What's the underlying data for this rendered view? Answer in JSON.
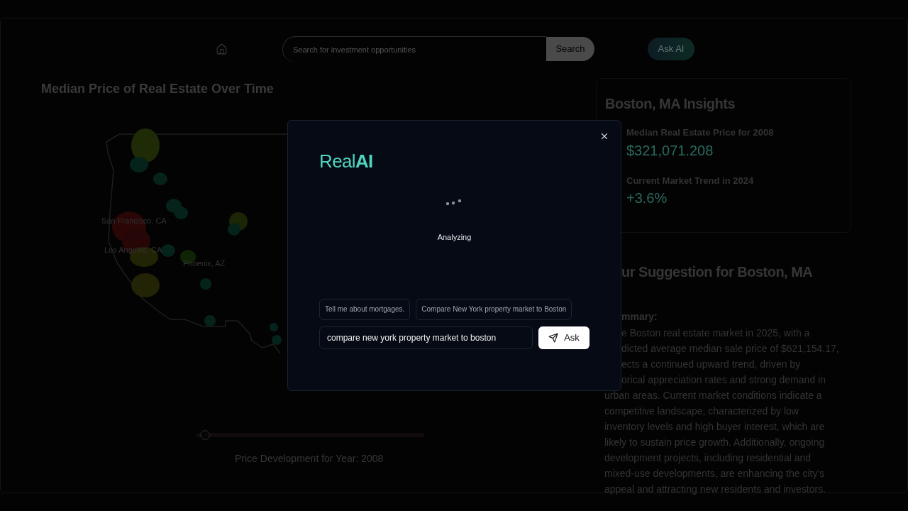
{
  "header": {
    "search": {
      "placeholder": "Search for investment opportunities"
    },
    "search_button": "Search",
    "ask_ai_button": "Ask AI"
  },
  "map_panel": {
    "title": "Median Price of Real Estate Over Time",
    "city_labels": [
      "San Francisco, CA",
      "Los Angeles, CA",
      "Phoenix, AZ"
    ],
    "year_slider": {
      "level": 0.02
    },
    "slider_caption": "Price Development for Year: 2008"
  },
  "insights": {
    "title": "Boston, MA Insights",
    "metrics": [
      {
        "label": "Median Real Estate Price for 2008",
        "value": "$321,071.208"
      },
      {
        "label": "Current Market Trend in 2024",
        "value": "+3.6%"
      }
    ]
  },
  "suggestion": {
    "title": "ur Suggestion for Boston, MA",
    "summary_heading": "mmary:",
    "summary_lines": [
      {
        "kind": "cut",
        "text": "e Boston real estate market in 2025, with a"
      },
      {
        "kind": "cut",
        "text": "dicted average median sale price of $621,154.17,"
      },
      {
        "kind": "cut",
        "text": "ects a continued upward trend, driven by"
      },
      {
        "kind": "cut",
        "text": "orical appreciation rates and strong demand in"
      },
      {
        "kind": "full",
        "text": "urban areas. Current market conditions indicate a"
      },
      {
        "kind": "full",
        "text": "competitive landscape, characterized by low"
      },
      {
        "kind": "full",
        "text": "inventory levels and high buyer interest, which are"
      },
      {
        "kind": "full",
        "text": "likely to sustain price growth. Additionally, ongoing"
      },
      {
        "kind": "full",
        "text": "development projects, including residential and"
      },
      {
        "kind": "full",
        "text": "mixed-use developments, are enhancing the city’s"
      },
      {
        "kind": "full",
        "text": "appeal and attracting new residents and investors."
      }
    ]
  },
  "modal": {
    "logo": {
      "light": "Real",
      "bold": "AI"
    },
    "status": "Analyzing",
    "suggestions": [
      "Tell me about mortgages.",
      "Compare New York property market to Boston"
    ],
    "input": {
      "value": "compare new york property market to boston"
    },
    "ask_button": "Ask"
  }
}
